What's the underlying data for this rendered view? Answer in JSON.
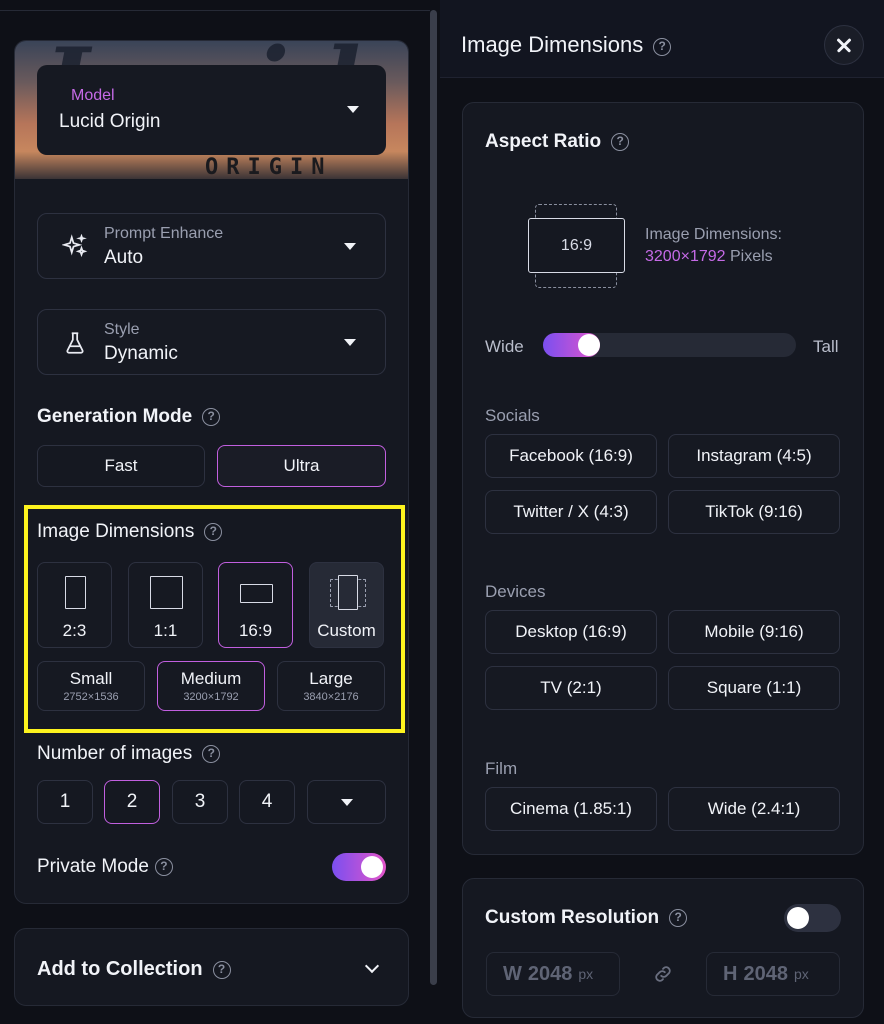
{
  "left": {
    "model": {
      "label": "Model",
      "value": "Lucid Origin",
      "banner_text": "Lucid",
      "banner_subtitle": "ORIGIN"
    },
    "prompt_enhance": {
      "label": "Prompt Enhance",
      "value": "Auto",
      "icon": "sparkles-icon"
    },
    "style": {
      "label": "Style",
      "value": "Dynamic",
      "icon": "flask-icon"
    },
    "generation_mode": {
      "title": "Generation Mode",
      "options": [
        "Fast",
        "Ultra"
      ],
      "selected": "Ultra"
    },
    "image_dimensions": {
      "title": "Image Dimensions",
      "aspect_options": [
        "2:3",
        "1:1",
        "16:9",
        "Custom"
      ],
      "selected_aspect": "16:9",
      "sizes": [
        {
          "name": "Small",
          "dims": "2752×1536"
        },
        {
          "name": "Medium",
          "dims": "3200×1792"
        },
        {
          "name": "Large",
          "dims": "3840×2176"
        }
      ],
      "selected_size": "Medium",
      "highlight_color": "#fdf31e"
    },
    "number_of_images": {
      "title": "Number of images",
      "options": [
        "1",
        "2",
        "3",
        "4"
      ],
      "selected": "2"
    },
    "private_mode": {
      "label": "Private Mode",
      "enabled": true
    },
    "add_to_collection": {
      "label": "Add to Collection"
    }
  },
  "right": {
    "title": "Image Dimensions",
    "aspect_ratio": {
      "title": "Aspect Ratio",
      "preview_label": "16:9",
      "dimensions_label": "Image Dimensions:",
      "dimensions_value": "3200×1792",
      "dimensions_unit": "Pixels",
      "slider": {
        "left_label": "Wide",
        "right_label": "Tall",
        "position": 0.15
      }
    },
    "groups": [
      {
        "label": "Socials",
        "items": [
          "Facebook (16:9)",
          "Instagram (4:5)",
          "Twitter / X (4:3)",
          "TikTok (9:16)"
        ]
      },
      {
        "label": "Devices",
        "items": [
          "Desktop (16:9)",
          "Mobile (9:16)",
          "TV (2:1)",
          "Square (1:1)"
        ]
      },
      {
        "label": "Film",
        "items": [
          "Cinema (1.85:1)",
          "Wide (2.4:1)"
        ]
      }
    ],
    "custom_resolution": {
      "title": "Custom Resolution",
      "enabled": false,
      "width": {
        "prefix": "W",
        "value": "2048",
        "unit": "px"
      },
      "height": {
        "prefix": "H",
        "value": "2048",
        "unit": "px"
      }
    }
  },
  "colors": {
    "accent": "#c15fdf",
    "accent_text": "#c56ae6",
    "background": "#0e1017",
    "card": "#151821"
  }
}
